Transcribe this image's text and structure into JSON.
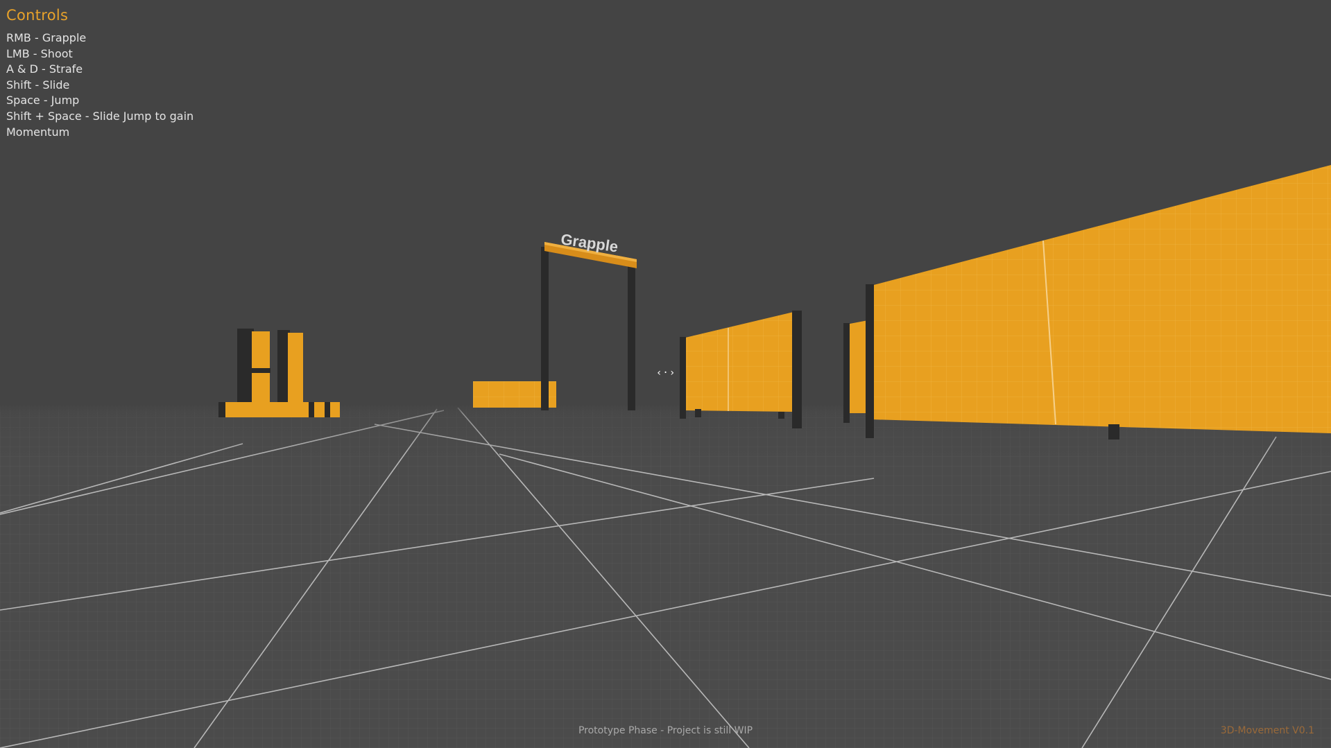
{
  "controls": {
    "title": "Controls",
    "items": [
      "RMB - Grapple",
      "LMB - Shoot",
      "A & D - Strafe",
      "Shift - Slide",
      "Space - Jump",
      "Shift + Space - Slide Jump to gain Momentum"
    ]
  },
  "scene": {
    "sign_label": "Grapple",
    "crosshair": "‹·›"
  },
  "footer": {
    "status": "Prototype Phase - Project is still WIP",
    "version": "3D-Movement V0.1"
  },
  "colors": {
    "sky": "#444444",
    "floor": "#4b4b4b",
    "orange": "#e8a020",
    "post": "#2a2a2a",
    "hud_title": "#e8a22a",
    "hud_text": "#e4e4e4"
  }
}
